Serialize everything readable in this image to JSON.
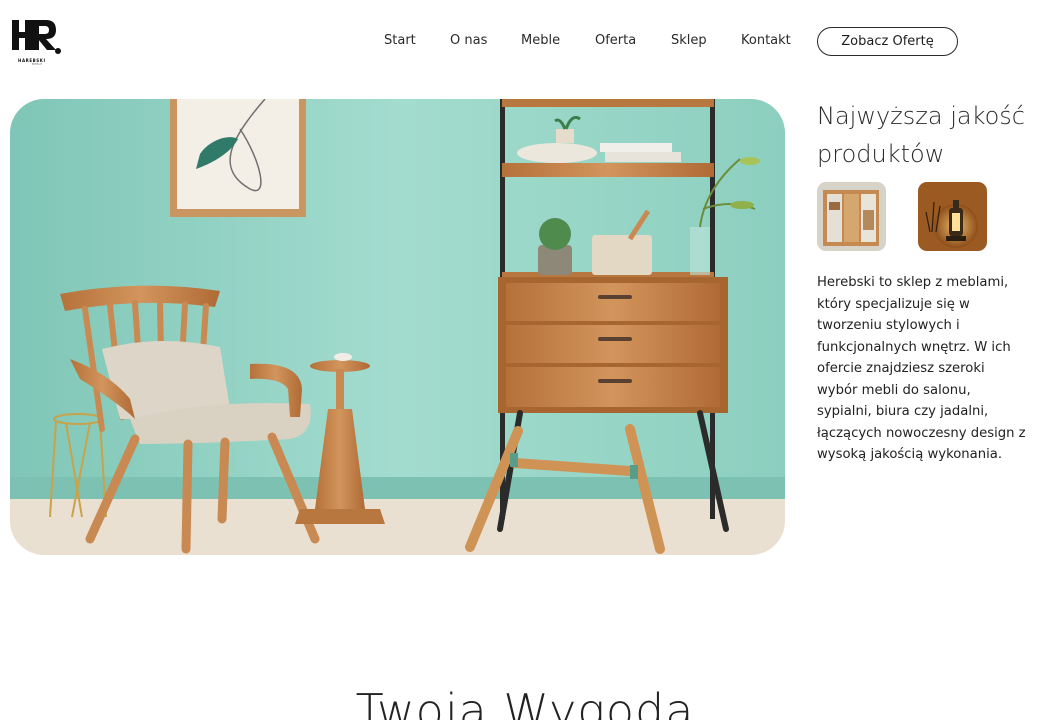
{
  "brand": {
    "logo_letters": "HR",
    "logo_name": "HAREBSKI",
    "logo_sub": "MEBLE"
  },
  "nav": {
    "items": [
      "Start",
      "O nas",
      "Meble",
      "Oferta",
      "Sklep",
      "Kontakt"
    ],
    "cta_label": "Zobacz Ofertę"
  },
  "hero": {
    "image_description": "living-room-furniture-photo"
  },
  "side": {
    "title": "Najwyższa jakość produktów",
    "description": "Herebski to sklep z meblami, który specjalizuje się w tworzeniu stylowych i funkcjonalnych wnętrz. W ich ofercie znajdziesz szeroki wybór mebli do salonu, sypialni, biura czy jadalni, łączących nowoczesny design z wysoką jakością wykonania."
  },
  "section": {
    "title": "Twoja Wygoda"
  },
  "colors": {
    "wall": "#92d2c3",
    "wood": "#c88a52",
    "text": "#1d1d1d"
  }
}
